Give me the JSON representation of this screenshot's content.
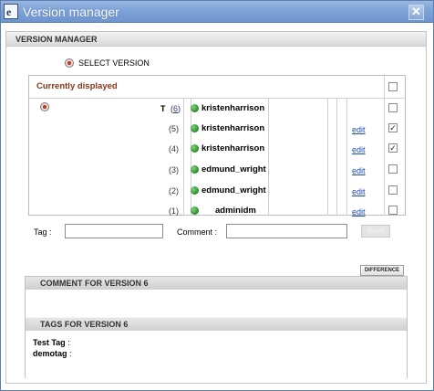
{
  "window": {
    "title": "Version manager",
    "title_icon": "document-icon",
    "close": "close-icon"
  },
  "header": {
    "section_title": "VERSION MANAGER"
  },
  "select_version": {
    "label": "SELECT VERSION",
    "icon": "radio-selected-icon"
  },
  "table": {
    "current_label": "Currently displayed",
    "current_checkbox_checked": false,
    "rows": [
      {
        "selected": true,
        "tag": "T",
        "number": "6",
        "user": "kristenharrison",
        "edit": "",
        "checked": false
      },
      {
        "selected": false,
        "tag": "",
        "number": "(5)",
        "user": "kristenharrison",
        "edit": "edit",
        "checked": true
      },
      {
        "selected": false,
        "tag": "",
        "number": "(4)",
        "user": "kristenharrison",
        "edit": "edit",
        "checked": true
      },
      {
        "selected": false,
        "tag": "",
        "number": "(3)",
        "user": "edmund_wright",
        "edit": "edit",
        "checked": false
      },
      {
        "selected": false,
        "tag": "",
        "number": "(2)",
        "user": "edmund_wright",
        "edit": "edit",
        "checked": false
      },
      {
        "selected": false,
        "tag": "",
        "number": "(1)",
        "user": "adminidm",
        "edit": "edit",
        "checked": false
      }
    ],
    "row1_open_paren": "(",
    "row1_close_paren": ")",
    "check_mark": "✓"
  },
  "form": {
    "tag_label": "Tag :",
    "tag_value": "",
    "comment_label": "Comment :",
    "comment_value": "",
    "save_label": "Save"
  },
  "difference_button": "DIFFERENCE",
  "comment_section": {
    "title": "COMMENT FOR VERSION 6",
    "text": ""
  },
  "tags_section": {
    "title": "TAGS FOR VERSION 6",
    "tags": [
      {
        "name": "Test Tag",
        "sep": ":"
      },
      {
        "name": "demotag",
        "sep": ":"
      }
    ]
  },
  "colors": {
    "titlebar": "#7da2d6",
    "accent_red": "#8b3516",
    "status_green": "#2a8a2a",
    "link": "#1a4bb0"
  }
}
